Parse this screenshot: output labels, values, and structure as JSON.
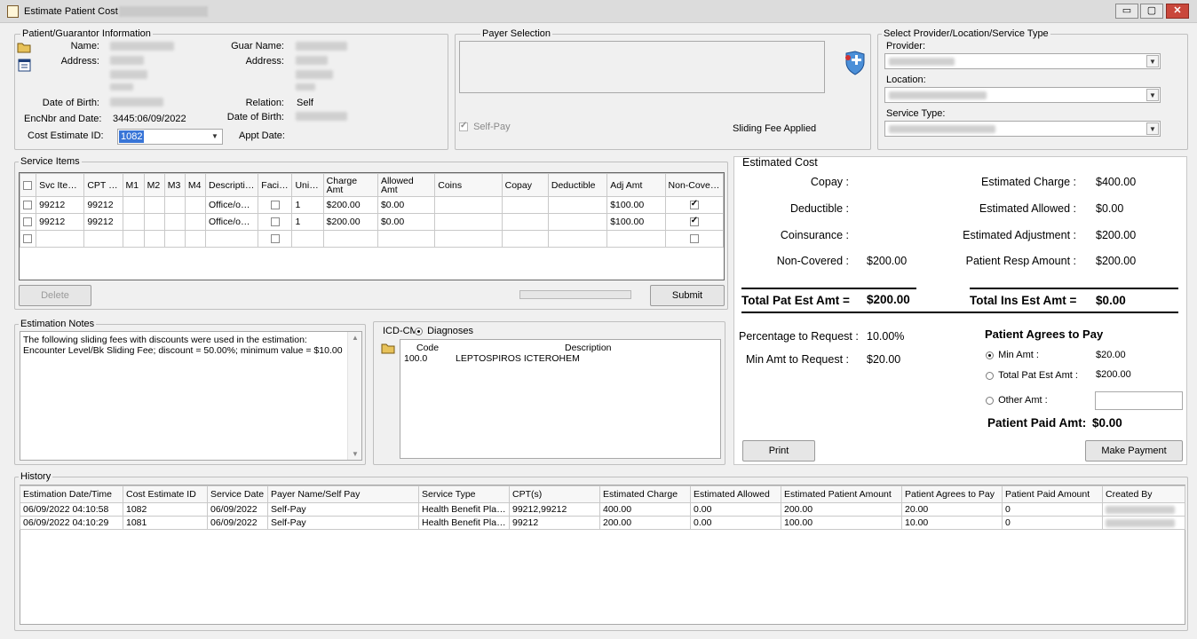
{
  "window": {
    "title": "Estimate Patient Cost -",
    "min_label": "▭",
    "max_label": "▢",
    "close_label": "✕"
  },
  "patient": {
    "legend": "Patient/Guarantor Information",
    "name_label": "Name:",
    "address_label": "Address:",
    "dob_label": "Date of Birth:",
    "enc_label": "EncNbr and Date:",
    "enc_value": "3445:06/09/2022",
    "cost_id_label": "Cost Estimate ID:",
    "cost_id_value": "1082",
    "guar_name_label": "Guar Name:",
    "guar_address_label": "Address:",
    "relation_label": "Relation:",
    "relation_value": "Self",
    "guar_dob_label": "Date of Birth:",
    "appt_label": "Appt Date:"
  },
  "payer": {
    "legend": "Payer Selection",
    "self_pay_label": "Self-Pay",
    "sliding_fee_label": "Sliding Fee Applied"
  },
  "provider": {
    "legend": "Select Provider/Location/Service Type",
    "provider_label": "Provider:",
    "location_label": "Location:",
    "service_type_label": "Service Type:"
  },
  "service_items": {
    "legend": "Service Items",
    "columns": [
      "",
      "Svc Item",
      "CPT Code",
      "M1",
      "M2",
      "M3",
      "M4",
      "Description",
      "Facility",
      "Unit(s)",
      "Charge Amt",
      "Allowed Amt",
      "Coins",
      "Copay",
      "Deductible",
      "Adj Amt",
      "Non-Covered"
    ],
    "rows": [
      {
        "svc": "99212",
        "cpt": "99212",
        "desc": "Office/out...",
        "units": "1",
        "charge": "$200.00",
        "allowed": "$0.00",
        "adj": "$100.00",
        "noncovered": true
      },
      {
        "svc": "99212",
        "cpt": "99212",
        "desc": "Office/out...",
        "units": "1",
        "charge": "$200.00",
        "allowed": "$0.00",
        "adj": "$100.00",
        "noncovered": true
      }
    ],
    "delete_label": "Delete",
    "submit_label": "Submit"
  },
  "notes": {
    "legend": "Estimation Notes",
    "line1": "The following sliding fees with discounts were used in the estimation:",
    "line2": "Encounter Level/Bk Sliding Fee; discount = 50.00%; minimum value = $10.00"
  },
  "icd": {
    "label": "ICD-CM",
    "diagnoses_label": "Diagnoses",
    "code_header": "Code",
    "desc_header": "Description",
    "rows": [
      {
        "code": "100.0",
        "desc": "LEPTOSPIROS ICTEROHEM"
      }
    ]
  },
  "estimated_cost": {
    "legend": "Estimated Cost",
    "copay_label": "Copay :",
    "deductible_label": "Deductible :",
    "coinsurance_label": "Coinsurance :",
    "noncovered_label": "Non-Covered :",
    "noncovered_value": "$200.00",
    "est_charge_label": "Estimated Charge :",
    "est_charge_value": "$400.00",
    "est_allowed_label": "Estimated Allowed :",
    "est_allowed_value": "$0.00",
    "est_adj_label": "Estimated Adjustment :",
    "est_adj_value": "$200.00",
    "pat_resp_label": "Patient Resp Amount :",
    "pat_resp_value": "$200.00",
    "total_pat_label": "Total Pat Est Amt =",
    "total_pat_value": "$200.00",
    "total_ins_label": "Total Ins Est Amt =",
    "total_ins_value": "$0.00",
    "pct_label": "Percentage to Request :",
    "pct_value": "10.00%",
    "min_amt_label": "Min Amt to Request :",
    "min_amt_value": "$20.00",
    "agrees_title": "Patient Agrees to Pay",
    "opt_min_label": "Min Amt :",
    "opt_min_value": "$20.00",
    "opt_total_label": "Total Pat Est Amt :",
    "opt_total_value": "$200.00",
    "opt_other_label": "Other Amt :",
    "paid_label": "Patient Paid Amt:",
    "paid_value": "$0.00",
    "print_label": "Print",
    "make_payment_label": "Make Payment"
  },
  "history": {
    "legend": "History",
    "columns": [
      "Estimation Date/Time",
      "Cost Estimate ID",
      "Service Date",
      "Payer Name/Self Pay",
      "Service Type",
      "CPT(s)",
      "Estimated Charge",
      "Estimated Allowed",
      "Estimated Patient Amount",
      "Patient Agrees to Pay",
      "Patient Paid Amount",
      "Created By"
    ],
    "rows": [
      [
        "06/09/2022 04:10:58",
        "1082",
        "06/09/2022",
        "Self-Pay",
        "Health Benefit Plan...",
        "99212,99212",
        "400.00",
        "0.00",
        "200.00",
        "20.00",
        "0",
        ""
      ],
      [
        "06/09/2022 04:10:29",
        "1081",
        "06/09/2022",
        "Self-Pay",
        "Health Benefit Plan...",
        "99212",
        "200.00",
        "0.00",
        "100.00",
        "10.00",
        "0",
        ""
      ]
    ]
  }
}
